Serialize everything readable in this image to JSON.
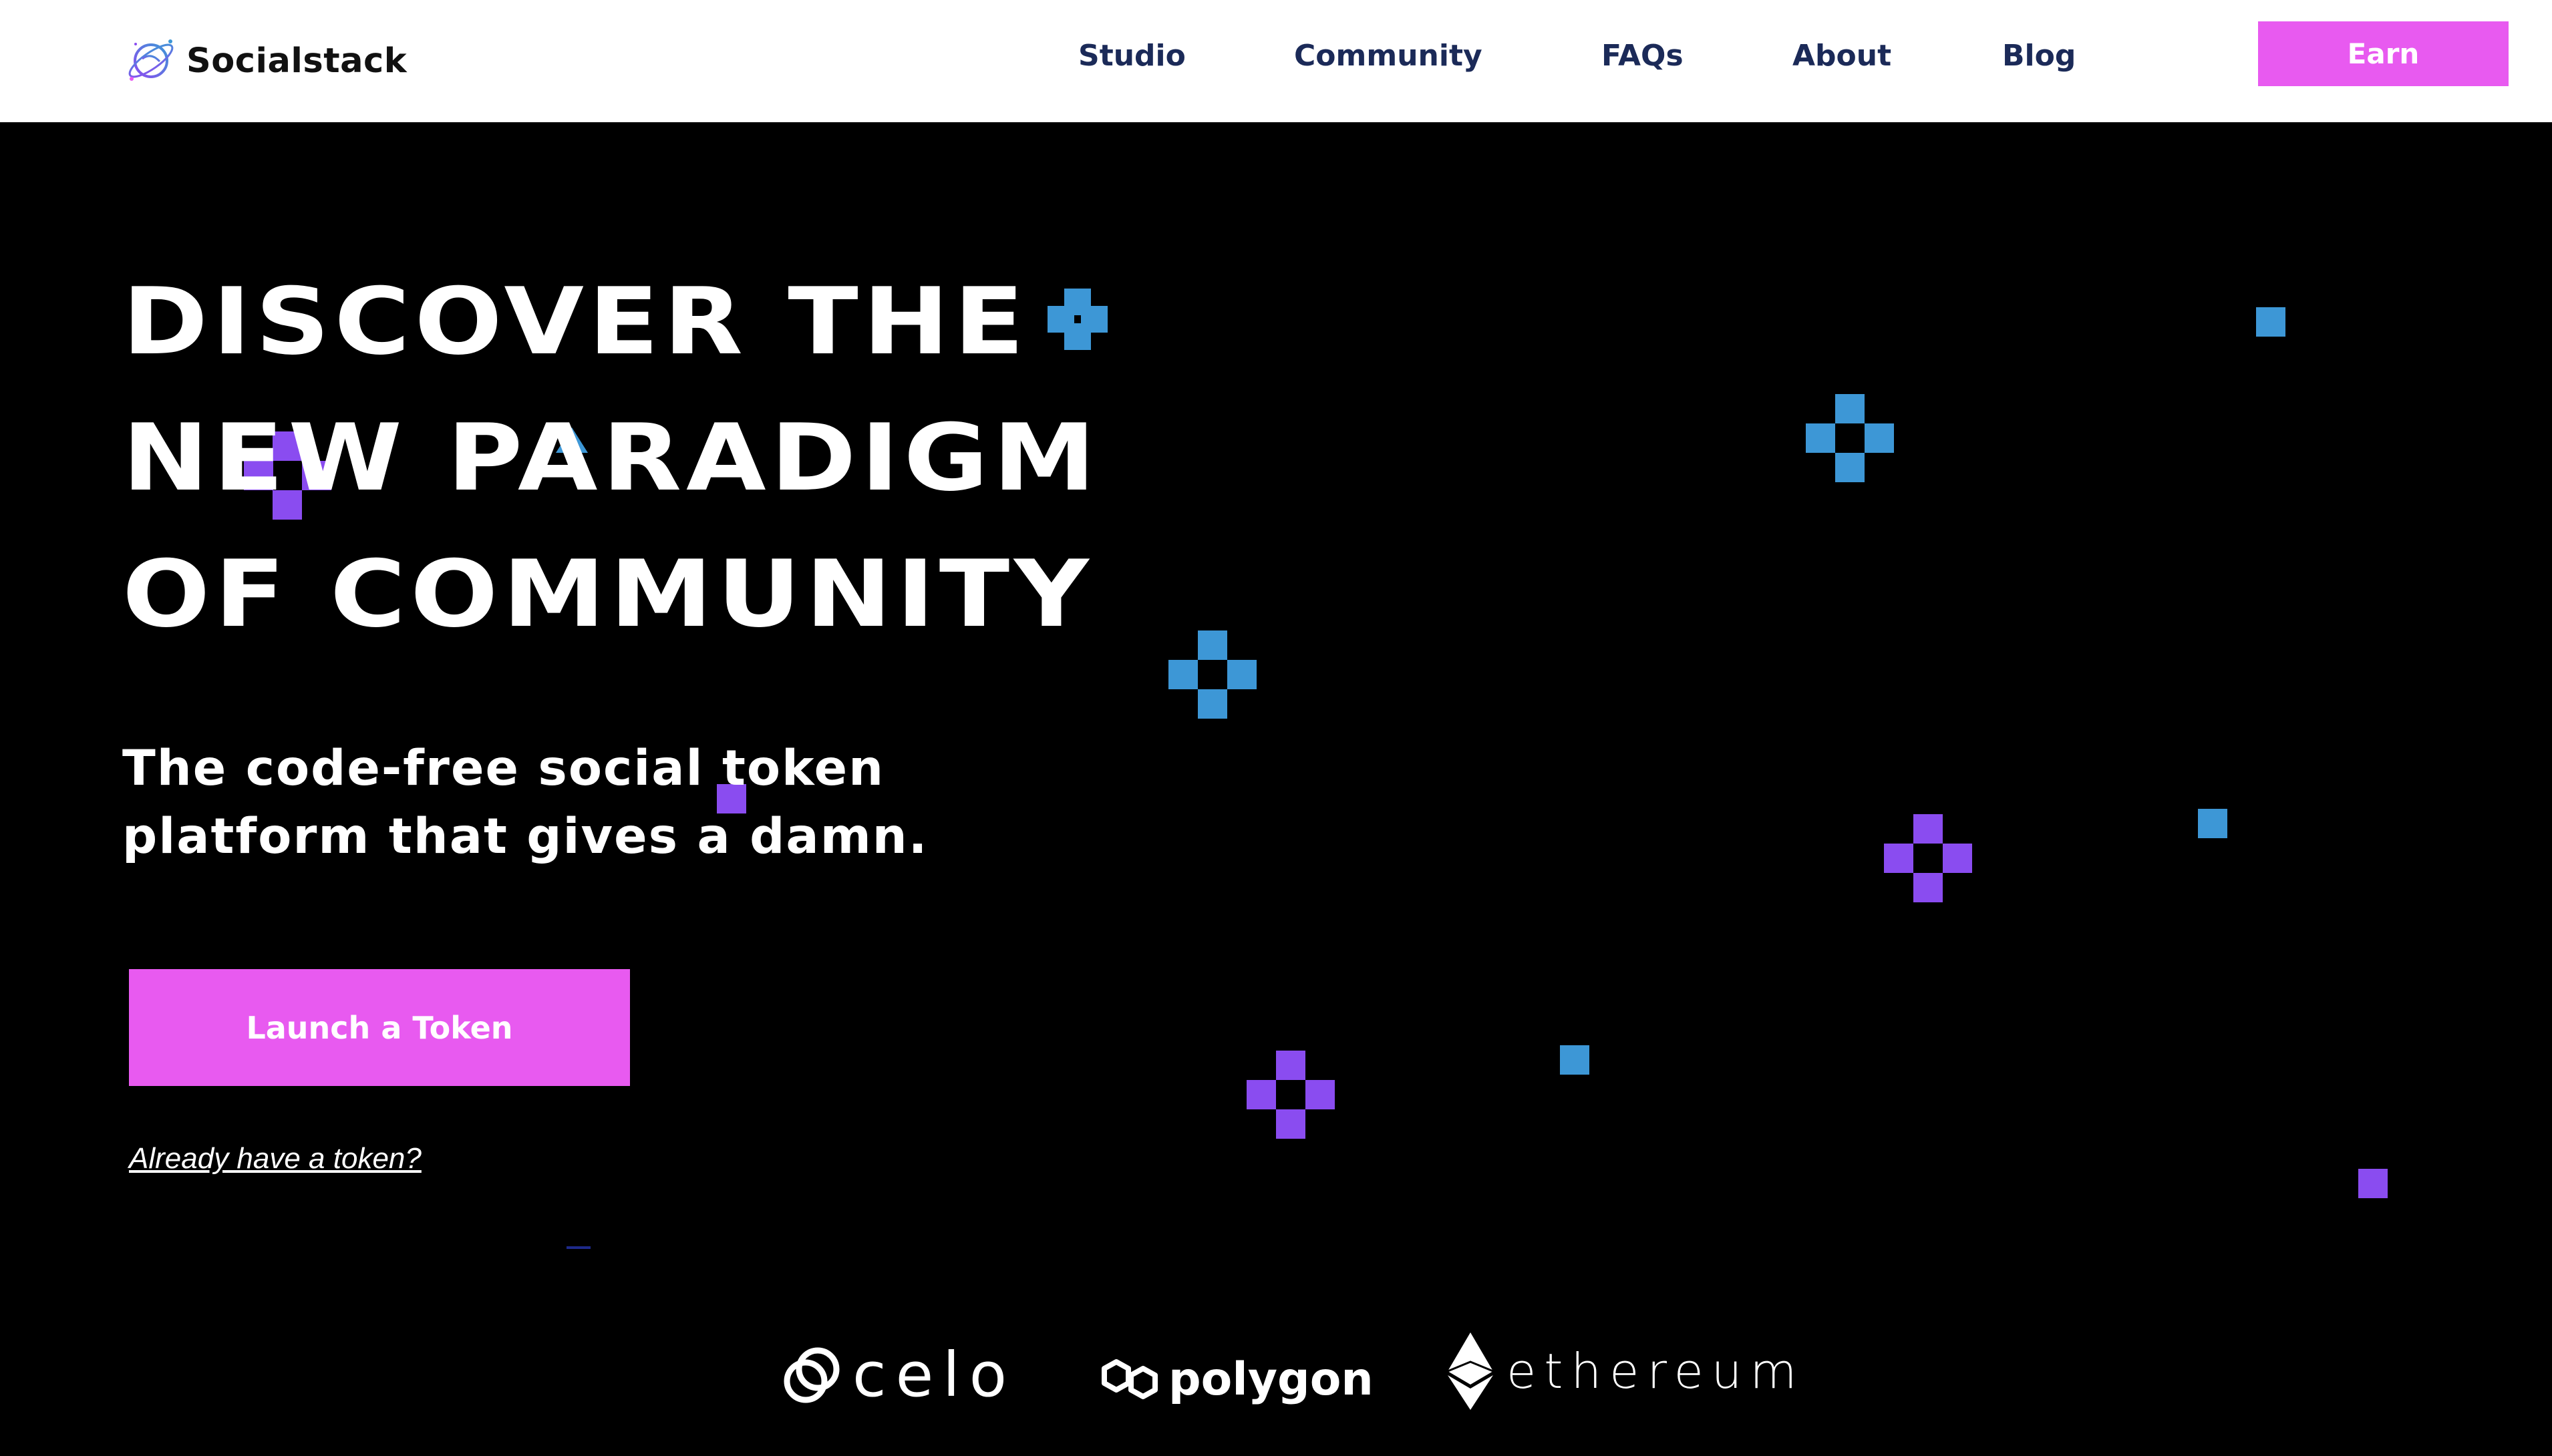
{
  "brand": {
    "name": "Socialstack"
  },
  "nav": {
    "items": [
      {
        "label": "Studio"
      },
      {
        "label": "Community"
      },
      {
        "label": "FAQs"
      },
      {
        "label": "About"
      },
      {
        "label": "Blog"
      }
    ],
    "earn_label": "Earn"
  },
  "hero": {
    "title_lines": [
      "DISCOVER THE",
      "NEW PARADIGM",
      "OF COMMUNITY"
    ],
    "subtitle_lines": [
      "The code-free social token",
      "platform that gives a damn."
    ],
    "cta_label": "Launch a Token",
    "secondary_link": "Already have a token?"
  },
  "chains": {
    "celo": "celo",
    "polygon": "polygon",
    "ethereum": "ethereum"
  },
  "colors": {
    "accent": "#e85af0",
    "nav_text": "#1b2a58",
    "pixel_blue": "#3d97d6",
    "pixel_purple": "#8a4cf0",
    "background": "#000000"
  }
}
